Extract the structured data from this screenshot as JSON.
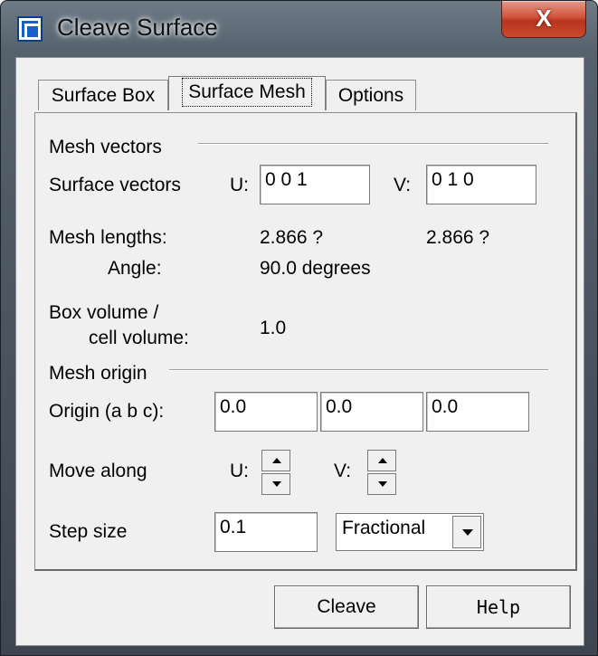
{
  "window": {
    "title": "Cleave Surface",
    "close_label": "X"
  },
  "tabs": [
    {
      "label": "Surface Box",
      "active": false
    },
    {
      "label": "Surface Mesh",
      "active": true
    },
    {
      "label": "Options",
      "active": false
    }
  ],
  "mesh_vectors": {
    "section_label": "Mesh vectors",
    "surface_vectors_label": "Surface vectors",
    "u_label": "U:",
    "u_value": "0  0  1",
    "v_label": "V:",
    "v_value": "0  1  0",
    "mesh_lengths_label": "Mesh lengths:",
    "u_length": "2.866 ?",
    "v_length": "2.866 ?",
    "angle_label": "Angle:",
    "angle_value": "90.0 degrees",
    "box_volume_label_1": "Box volume /",
    "box_volume_label_2": "cell volume:",
    "box_volume_value": "1.0"
  },
  "mesh_origin": {
    "section_label": "Mesh origin",
    "origin_label": "Origin (a b c):",
    "a_value": "0.0",
    "b_value": "0.0",
    "c_value": "0.0",
    "move_along_label": "Move along",
    "u_label": "U:",
    "v_label": "V:",
    "step_size_label": "Step size",
    "step_size_value": "0.1",
    "step_mode": "Fractional"
  },
  "buttons": {
    "cleave": "Cleave",
    "help": "Help"
  }
}
